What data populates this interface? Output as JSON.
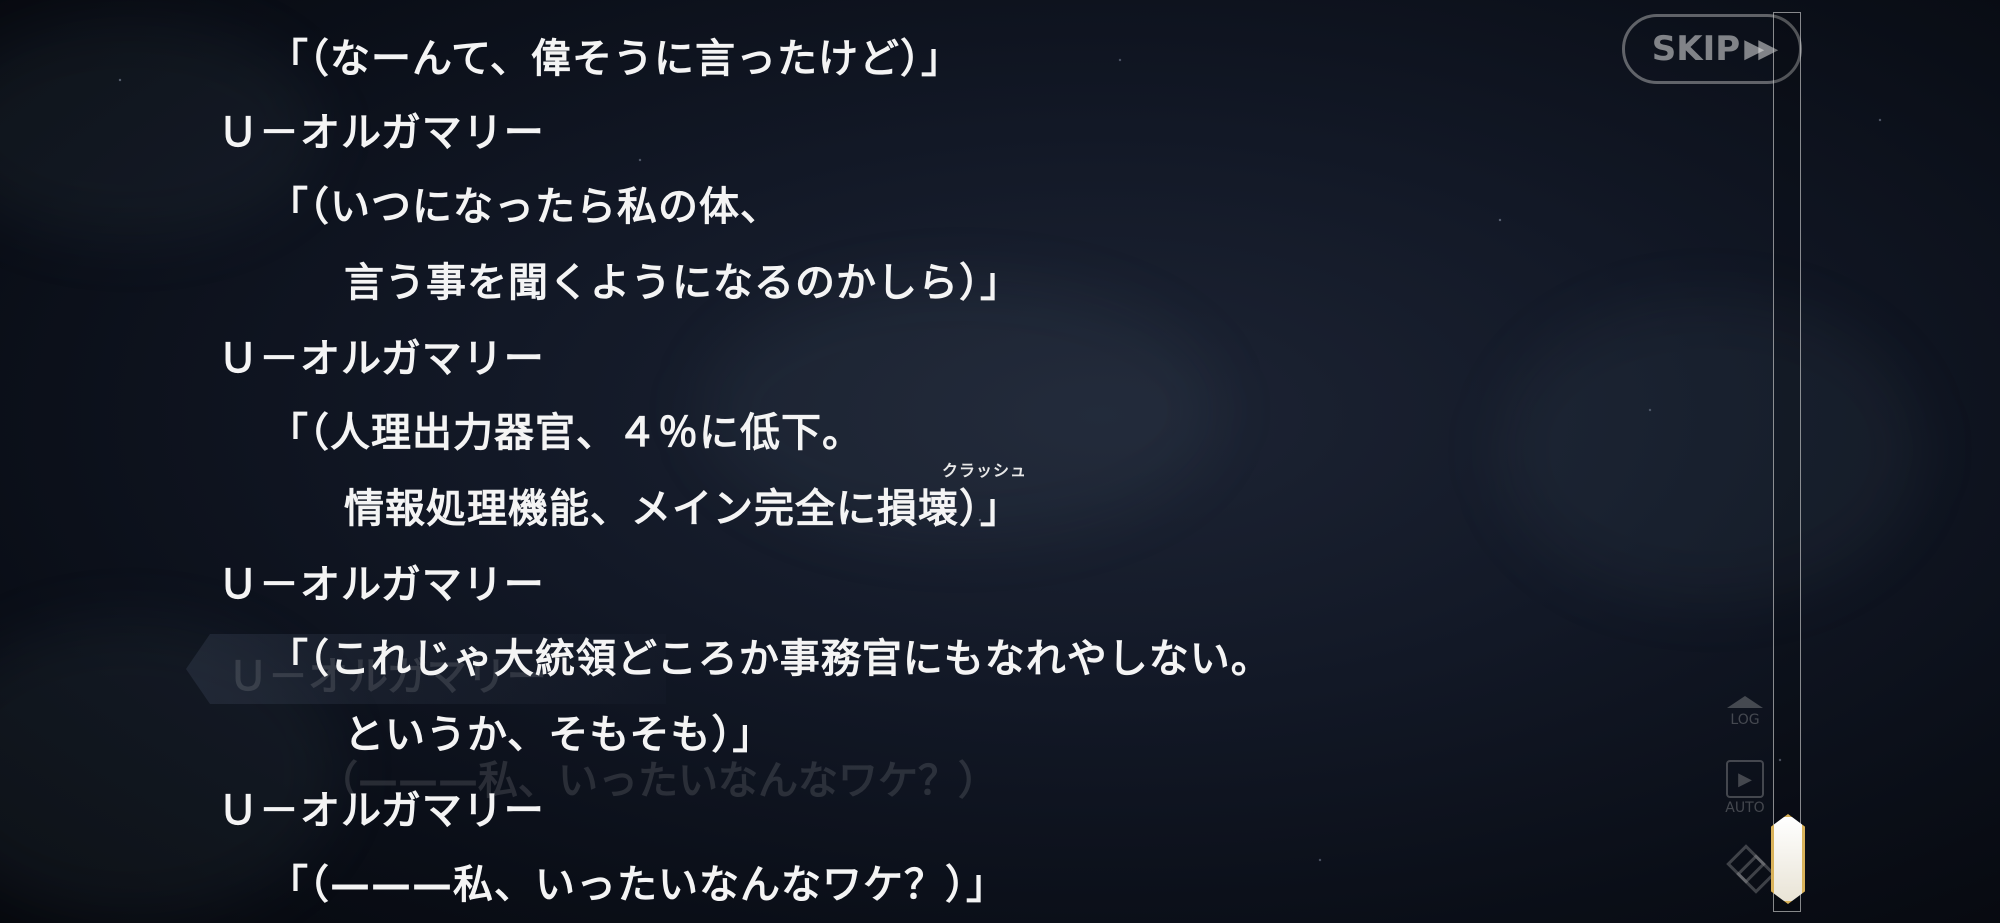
{
  "log_entries": [
    {
      "lines": [
        "「（なーんて、偉そうに言ったけど）」"
      ]
    },
    {
      "speaker": "Ｕ－オルガマリー",
      "lines": [
        "「（いつになったら私の体、",
        "言う事を聞くようになるのかしら）」"
      ]
    },
    {
      "speaker": "Ｕ－オルガマリー",
      "lines": [
        "「（人理出力器官、４％に低下。",
        "情報処理機能、メイン完全に損壊）」"
      ],
      "ruby": "クラッシュ"
    },
    {
      "speaker": "Ｕ－オルガマリー",
      "lines": [
        "「（これじゃ大統領どころか事務官にもなれやしない。",
        "というか、そもそも）」"
      ]
    },
    {
      "speaker": "Ｕ－オルガマリー",
      "lines": [
        "「（———私、いったいなんなワケ？）」"
      ]
    }
  ],
  "background_dialogue": {
    "speaker": "Ｕ－オルガマリー",
    "text": "（———私、いったいなんなワケ？）"
  },
  "controls": {
    "skip_label": "SKIP",
    "skip_arrows": "▶▶",
    "log_label": "LOG",
    "auto_label": "AUTO",
    "auto_icon": "▶"
  },
  "scroll": {
    "position_fraction": 1.0
  }
}
